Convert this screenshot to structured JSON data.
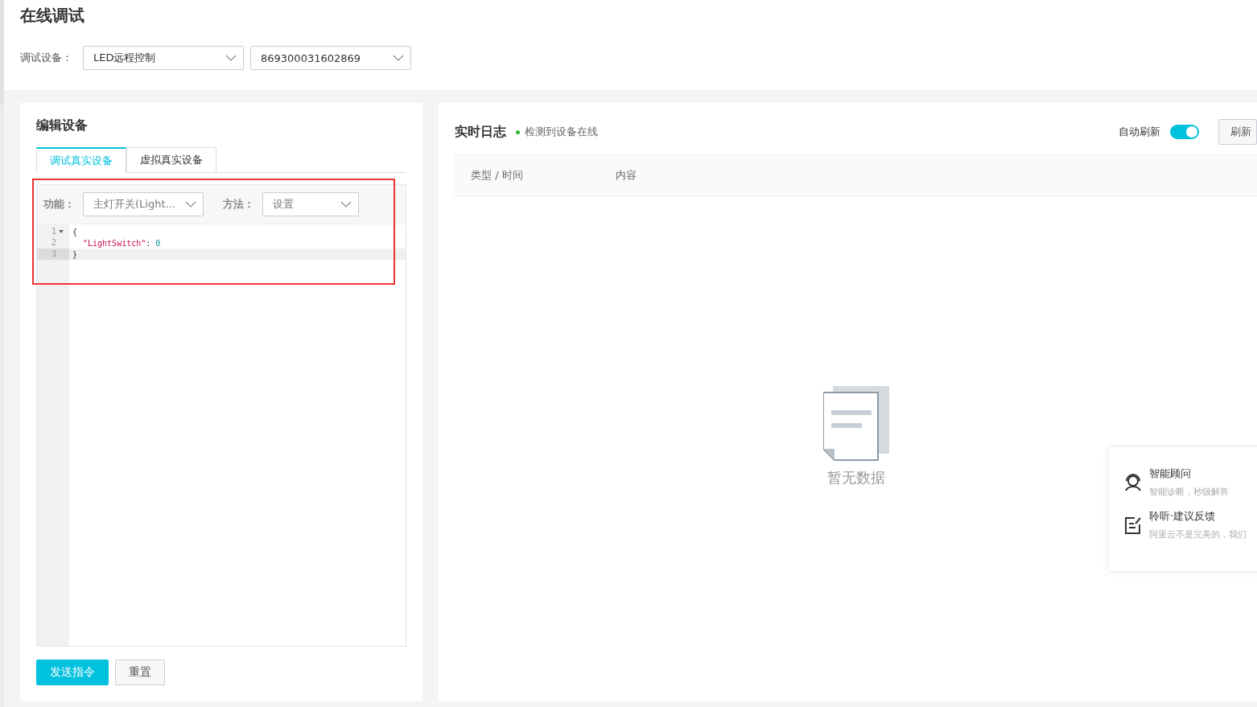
{
  "page": {
    "title": "在线调试"
  },
  "device_picker": {
    "label": "调试设备：",
    "product": "LED远程控制",
    "device": "869300031602869"
  },
  "editor_panel": {
    "title": "编辑设备",
    "tabs": [
      {
        "label": "调试真实设备",
        "selected": true
      },
      {
        "label": "虚拟真实设备",
        "selected": false
      }
    ],
    "function_label": "功能：",
    "function_value": "主灯开关(Light…",
    "method_label": "方法：",
    "method_value": "设置",
    "code_lines": [
      {
        "number": "1",
        "foldable": true,
        "active": false,
        "indented": false,
        "tokens": [
          {
            "kind": "punct",
            "text": "{"
          }
        ]
      },
      {
        "number": "2",
        "foldable": false,
        "active": false,
        "indented": true,
        "tokens": [
          {
            "kind": "key",
            "text": "\"LightSwitch\""
          },
          {
            "kind": "punct",
            "text": ": "
          },
          {
            "kind": "number",
            "text": "0"
          }
        ]
      },
      {
        "number": "3",
        "foldable": false,
        "active": true,
        "indented": false,
        "tokens": [
          {
            "kind": "punct",
            "text": "}"
          }
        ]
      }
    ],
    "buttons": [
      {
        "label": "发送指令",
        "kind": "primary"
      },
      {
        "label": "重置",
        "kind": "default"
      }
    ]
  },
  "log_panel": {
    "title": "实时日志",
    "status": "检测到设备在线",
    "auto_refresh": {
      "label": "自动刷新",
      "on": true
    },
    "refresh_button": "刷新",
    "columns": [
      "类型 / 时间",
      "内容"
    ],
    "empty_text": "暂无数据"
  },
  "help_card": {
    "items": [
      {
        "kind": "advisor",
        "title": "智能顾问",
        "subtitle": "智能诊断，秒级解答"
      },
      {
        "kind": "feedback",
        "title": "聆听·建议反馈",
        "subtitle": "阿里云不是完美的，我们"
      }
    ]
  },
  "highlight_frame": {
    "shown": true
  }
}
